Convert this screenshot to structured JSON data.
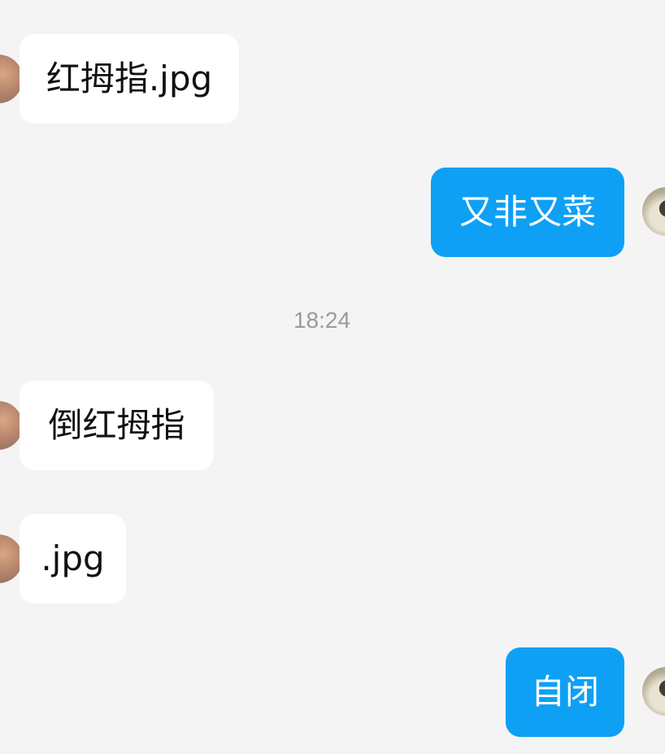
{
  "chat": {
    "timestamp": "18:24",
    "messages": [
      {
        "side": "in",
        "text": "红拇指.jpg"
      },
      {
        "side": "out",
        "text": "又非又菜"
      },
      {
        "side": "in",
        "text": "倒红拇指"
      },
      {
        "side": "in",
        "text": ".jpg"
      },
      {
        "side": "out",
        "text": "自闭"
      }
    ]
  },
  "colors": {
    "background": "#f4f4f4",
    "incoming_bubble": "#ffffff",
    "outgoing_bubble": "#0ea0f5",
    "timestamp_text": "#9a9a9a"
  }
}
